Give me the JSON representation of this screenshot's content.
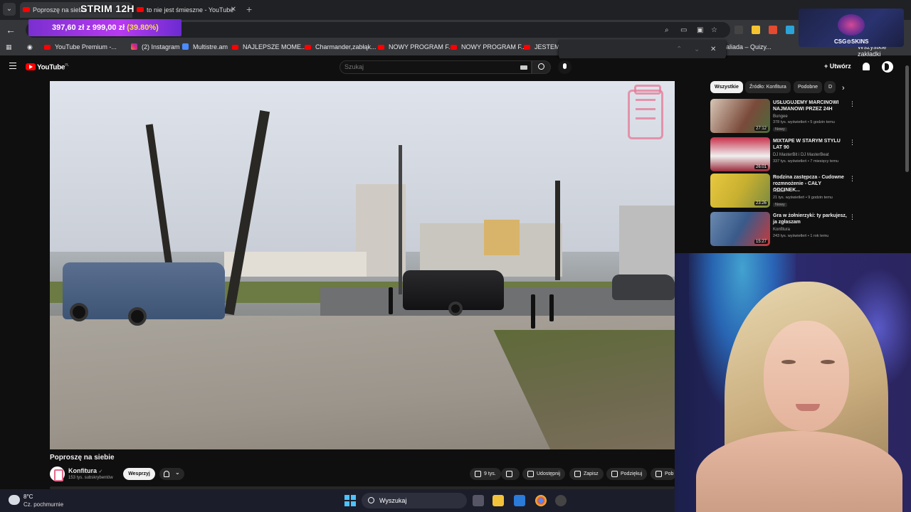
{
  "browser": {
    "tabs": [
      {
        "title": "Poproszę na siebie",
        "active": true
      },
      {
        "title": "to nie jest śmieszne - YouTube",
        "active": false
      }
    ],
    "stream_overlay_title": "STRIM 12H",
    "url_fragment": "9409g",
    "price_overlay": {
      "amount": "397,60 zł z 999,00 zł",
      "percent": "(39.80%)"
    },
    "bookmarks": [
      {
        "label": "YouTube Premium -...",
        "icon": "youtube-icon"
      },
      {
        "label": "(2) Instagram",
        "icon": "instagram-icon"
      },
      {
        "label": "Multistre.am",
        "icon": "multistream-icon"
      },
      {
        "label": "NAJLEPSZE MOME...",
        "icon": "youtube-icon"
      },
      {
        "label": "Charmander,zabłąk...",
        "icon": "youtube-icon"
      },
      {
        "label": "NOWY PROGRAM F...",
        "icon": "youtube-icon"
      },
      {
        "label": "NOWY PROGRAM F...",
        "icon": "youtube-icon"
      },
      {
        "label": "JESTEM D",
        "icon": "youtube-icon"
      },
      {
        "label": "aliada – Quizy...",
        "icon": "site-icon"
      }
    ],
    "all_bookmarks_label": "Wszystkie zakładki",
    "sponsor_logo_text": "CSG⊙SKINS"
  },
  "youtube": {
    "region": "PL",
    "logo_text": "YouTube",
    "search_placeholder": "Szukaj",
    "create_label": "Utwórz",
    "video": {
      "title": "Poproszę na siebie",
      "channel": "Konfitura",
      "subscribers": "153 tys. subskrybentów",
      "support_label": "Wesprzyj",
      "actions": [
        {
          "label": "9 tys.",
          "icon": "like-icon"
        },
        {
          "label": "",
          "icon": "dislike-icon"
        },
        {
          "label": "Udostępnij",
          "icon": "share-icon"
        },
        {
          "label": "Zapisz",
          "icon": "save-icon"
        },
        {
          "label": "Podziękuj",
          "icon": "thanks-icon"
        },
        {
          "label": "Pob",
          "icon": "download-icon"
        }
      ]
    },
    "chips": [
      "Wszystkie",
      "Źródło: Konfitura",
      "Podobne",
      "D"
    ],
    "recommendations": [
      {
        "title": "USŁUGUJEMY MARCINOWI NAJMANOWI PRZEZ 24H",
        "channel": "Bungee",
        "meta": "378 tys. wyświetleń • 5 godzin temu",
        "badge": "Nowy",
        "duration": "27:12",
        "thumb_color": "#7a4a3a"
      },
      {
        "title": "MIXTAPE W STARYM STYLU LAT 90",
        "channel": "DJ MasterBit i DJ MasterBeat",
        "meta": "337 tys. wyświetleń • 7 miesięcy temu",
        "badge": "",
        "duration": "26:01",
        "thumb_color": "#9a2a3a"
      },
      {
        "title": "Rodzina zastępcza - Cudowne rozmnożenie - CAŁY ODCINEK...",
        "channel": "Polsat",
        "meta": "21 tys. wyświetleń • 9 godzin temu",
        "badge": "Nowy",
        "duration": "23:26",
        "thumb_color": "#c8b030"
      },
      {
        "title": "Gra w żołnierzyki: ty parkujesz, ja zgłaszam",
        "channel": "Konfitura",
        "meta": "243 tys. wyświetleń • 1 rok temu",
        "badge": "",
        "duration": "15:27",
        "thumb_color": "#3a5a8a"
      }
    ]
  },
  "taskbar": {
    "temperature": "8°C",
    "condition": "Cz. pochmurnie",
    "search_label": "Wyszukaj"
  },
  "colors": {
    "accent": "#ff0000",
    "overlay_purple": "#b83af0",
    "overlay_pct": "#f6e23a"
  }
}
